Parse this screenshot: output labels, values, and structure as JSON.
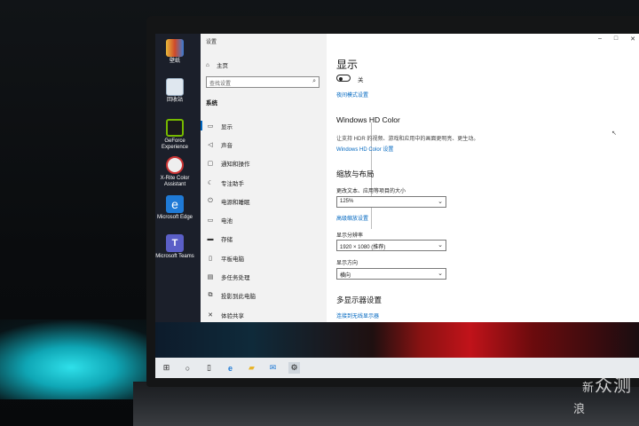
{
  "window": {
    "title": "设置",
    "controls": [
      "–",
      "□",
      "✕"
    ]
  },
  "sidebar": {
    "home": "主页",
    "search_placeholder": "查找设置",
    "section": "系统",
    "items": [
      {
        "label": "显示",
        "icon": "monitor-icon",
        "glyph": "▭"
      },
      {
        "label": "声音",
        "icon": "speaker-icon",
        "glyph": "◁"
      },
      {
        "label": "通知和操作",
        "icon": "notification-icon",
        "glyph": "▢"
      },
      {
        "label": "专注助手",
        "icon": "moon-icon",
        "glyph": "☾"
      },
      {
        "label": "电源和睡眠",
        "icon": "power-icon",
        "glyph": "⏻"
      },
      {
        "label": "电池",
        "icon": "battery-icon",
        "glyph": "▭"
      },
      {
        "label": "存储",
        "icon": "storage-icon",
        "glyph": "▬"
      },
      {
        "label": "平板电脑",
        "icon": "tablet-icon",
        "glyph": "▯"
      },
      {
        "label": "多任务处理",
        "icon": "multitask-icon",
        "glyph": "▤"
      },
      {
        "label": "投影到此电脑",
        "icon": "project-icon",
        "glyph": "⧉"
      },
      {
        "label": "体验共享",
        "icon": "share-icon",
        "glyph": "✕"
      }
    ]
  },
  "content": {
    "title": "显示",
    "toggle_label": "关",
    "night_light_link": "夜间模式设置",
    "hdr_heading": "Windows HD Color",
    "hdr_desc": "让支持 HDR 的视频、游戏和应用中的画面更明亮、更生动。",
    "hdr_link": "Windows HD Color 设置",
    "scale_heading": "缩放与布局",
    "scale_label": "更改文本、应用等项目的大小",
    "scale_value": "125%",
    "scale_link": "高级缩放设置",
    "resolution_label": "显示分辨率",
    "resolution_value": "1920 × 1080 (推荐)",
    "orientation_label": "显示方向",
    "orientation_value": "横向",
    "multi_heading": "多显示器设置",
    "multi_link": "连接到无线显示器"
  },
  "desktop_icons": [
    {
      "label": "壁纸",
      "icon": "wallpaper-app-icon",
      "color": "#e7b93a"
    },
    {
      "label": "回收站",
      "icon": "recycle-bin-icon",
      "color": "#c9d7e6"
    },
    {
      "label": "GeForce Experience",
      "icon": "geforce-icon",
      "color": "#76b900"
    },
    {
      "label": "X-Rite Color Assistant",
      "icon": "xrite-icon",
      "color": "#d9d9d9"
    },
    {
      "label": "Microsoft Edge",
      "icon": "edge-icon",
      "color": "#1f7ad6"
    },
    {
      "label": "Microsoft Teams",
      "icon": "teams-icon",
      "color": "#5b5fc7"
    }
  ],
  "taskbar": [
    {
      "name": "start-icon",
      "glyph": "⊞"
    },
    {
      "name": "search-taskbar-icon",
      "glyph": "○"
    },
    {
      "name": "task-view-icon",
      "glyph": "▯"
    },
    {
      "name": "edge-taskbar-icon",
      "glyph": "e"
    },
    {
      "name": "explorer-icon",
      "glyph": "▰"
    },
    {
      "name": "mail-icon",
      "glyph": "✉"
    },
    {
      "name": "settings-taskbar-icon",
      "glyph": "⚙"
    }
  ],
  "watermark": {
    "line1": "新",
    "line2": "浪",
    "text": "众测"
  }
}
